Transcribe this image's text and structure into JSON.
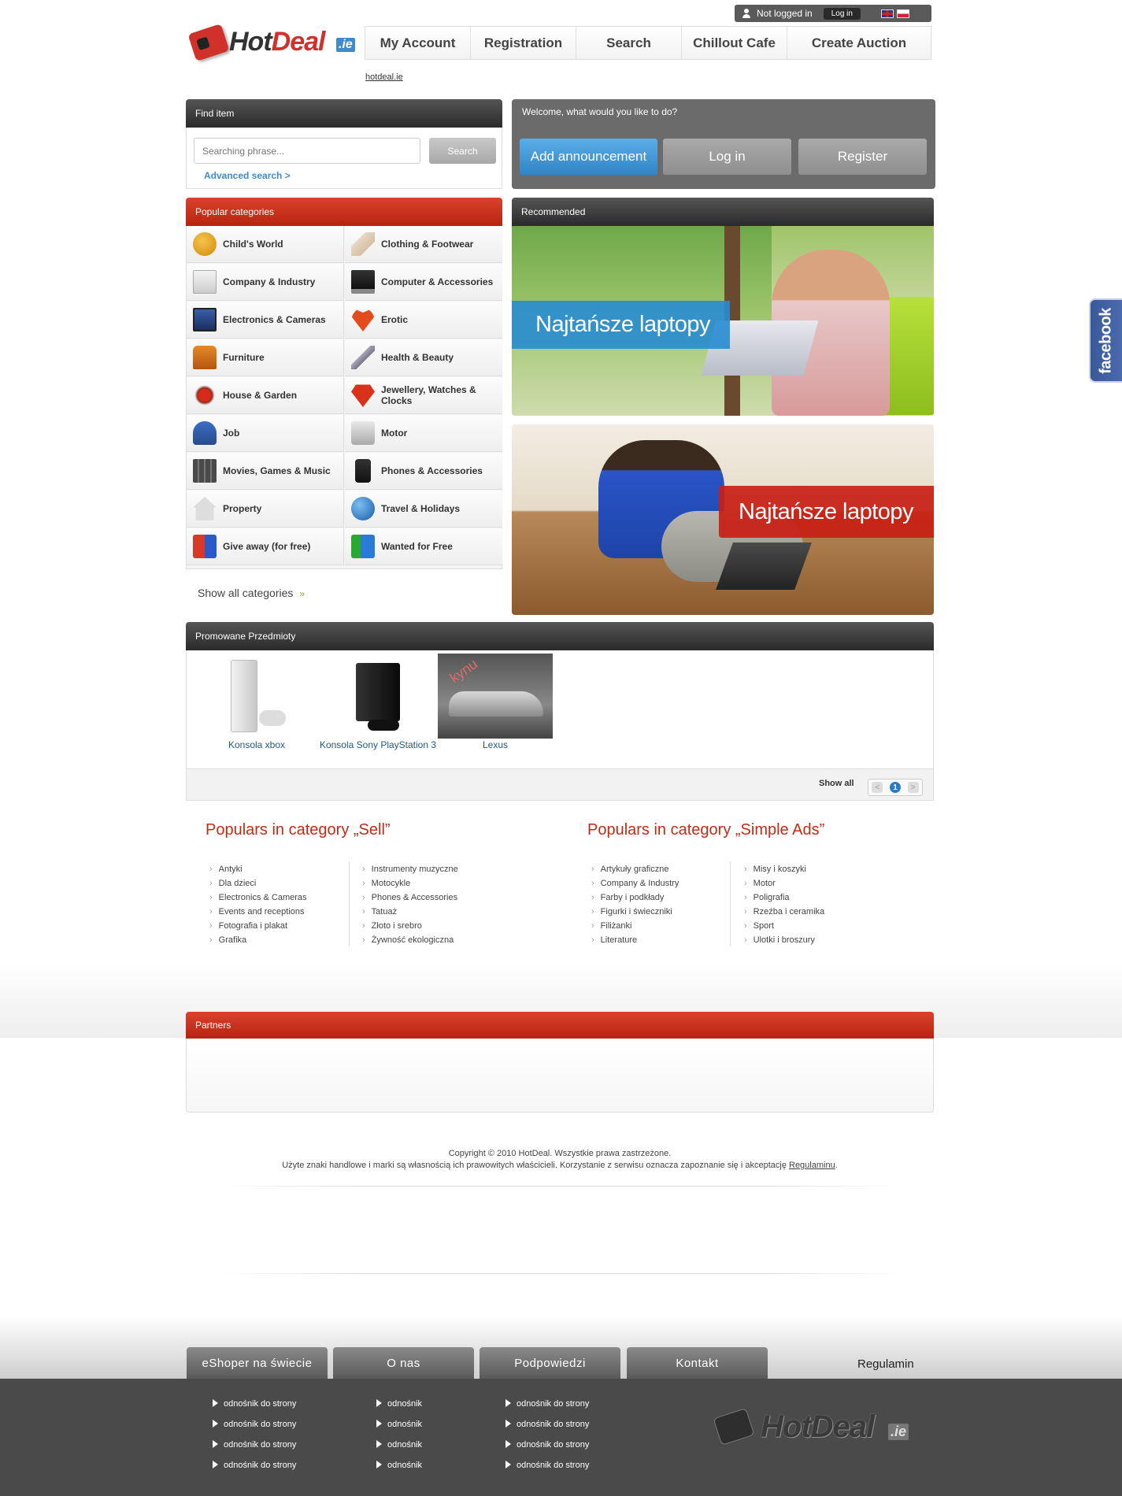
{
  "header": {
    "login_status": "Not logged in",
    "login_button": "Log in",
    "languages": [
      "uk-flag-icon",
      "pl-flag-icon"
    ],
    "logo": {
      "text_hot": "Hot",
      "text_deal": "Deal",
      "suffix": ".ie"
    },
    "nav": [
      "My Account",
      "Registration",
      "Search",
      "Chillout Cafe",
      "Create Auction"
    ],
    "domain_link": "hotdeal.ie"
  },
  "find_item": {
    "title": "Find item",
    "placeholder": "Searching phrase...",
    "search_button": "Search",
    "advanced": "Advanced search >"
  },
  "welcome": {
    "title": "Welcome, what would you like to do?",
    "add": "Add announcement",
    "login": "Log in",
    "register": "Register"
  },
  "categories": {
    "title": "Popular categories",
    "items": [
      "Child's World",
      "Clothing & Footwear",
      "Company & Industry",
      "Computer & Accessories",
      "Electronics & Cameras",
      "Erotic",
      "Furniture",
      "Health & Beauty",
      "House & Garden",
      "Jewellery, Watches & Clocks",
      "Job",
      "Motor",
      "Movies, Games & Music",
      "Phones & Accessories",
      "Property",
      "Travel & Holidays",
      "Give away (for free)",
      "Wanted for Free"
    ],
    "show_all": "Show all categories",
    "show_all_arrow": "»"
  },
  "recommended": {
    "title": "Recommended",
    "banner1": "Najtańsze laptopy",
    "banner2": "Najtańsze laptopy"
  },
  "promo": {
    "title": "Promowane Przedmioty",
    "items": [
      "Konsola xbox",
      "Konsola Sony PlayStation 3",
      "Lexus"
    ],
    "watermark": "kynu",
    "show_all": "Show all",
    "pager": {
      "prev": "<",
      "current": "1",
      "next": ">"
    }
  },
  "populars": {
    "sell_title": "Populars in category „Sell”",
    "sell_col1": [
      "Antyki",
      "Dla dzieci",
      "Electronics & Cameras",
      "Events and receptions",
      "Fotografia i plakat",
      "Grafika"
    ],
    "sell_col2": [
      "Instrumenty muzyczne",
      "Motocykle",
      "Phones & Accessories",
      "Tatuaż",
      "Złoto i srebro",
      "Żywność ekologiczna"
    ],
    "ads_title": "Populars in category „Simple Ads”",
    "ads_col1": [
      "Artykuły graficzne",
      "Company & Industry",
      "Farby i podkłady",
      "Figurki i świeczniki",
      "Filiżanki",
      "Literature"
    ],
    "ads_col2": [
      "Misy i koszyki",
      "Motor",
      "Poligrafia",
      "Rzeźba i ceramika",
      "Sport",
      "Ulotki i broszury"
    ]
  },
  "partners": {
    "title": "Partners"
  },
  "copyright": {
    "line1": "Copyright © 2010 HotDeal. Wszystkie prawa zastrzeżone.",
    "line2": "Użyte znaki handlowe i marki są własnością ich prawowitych właścicieli. Korzystanie z serwisu oznacza zapoznanie się i akceptację ",
    "regulamin_link": "Regulaminu",
    "line2_end": "."
  },
  "footer": {
    "tabs": [
      "eShoper  na świecie",
      "O nas",
      "Podpowiedzi",
      "Kontakt"
    ],
    "regulamin": "Regulamin",
    "col1": [
      "odnośnik do strony",
      "odnośnik do strony",
      "odnośnik do strony",
      "odnośnik do strony"
    ],
    "col2": [
      "odnośnik",
      "odnośnik",
      "odnośnik",
      "odnośnik"
    ],
    "col3": [
      "odnośnik do strony",
      "odnośnik do strony",
      "odnośnik do strony",
      "odnośnik do strony"
    ],
    "logo": {
      "text": "HotDeal",
      "suffix": ".ie"
    }
  },
  "facebook": {
    "label": "facebook"
  },
  "colors": {
    "accent_red": "#c62a14",
    "accent_blue": "#3e8ccd",
    "dark": "#4a4a4a",
    "facebook": "#3b5998"
  }
}
